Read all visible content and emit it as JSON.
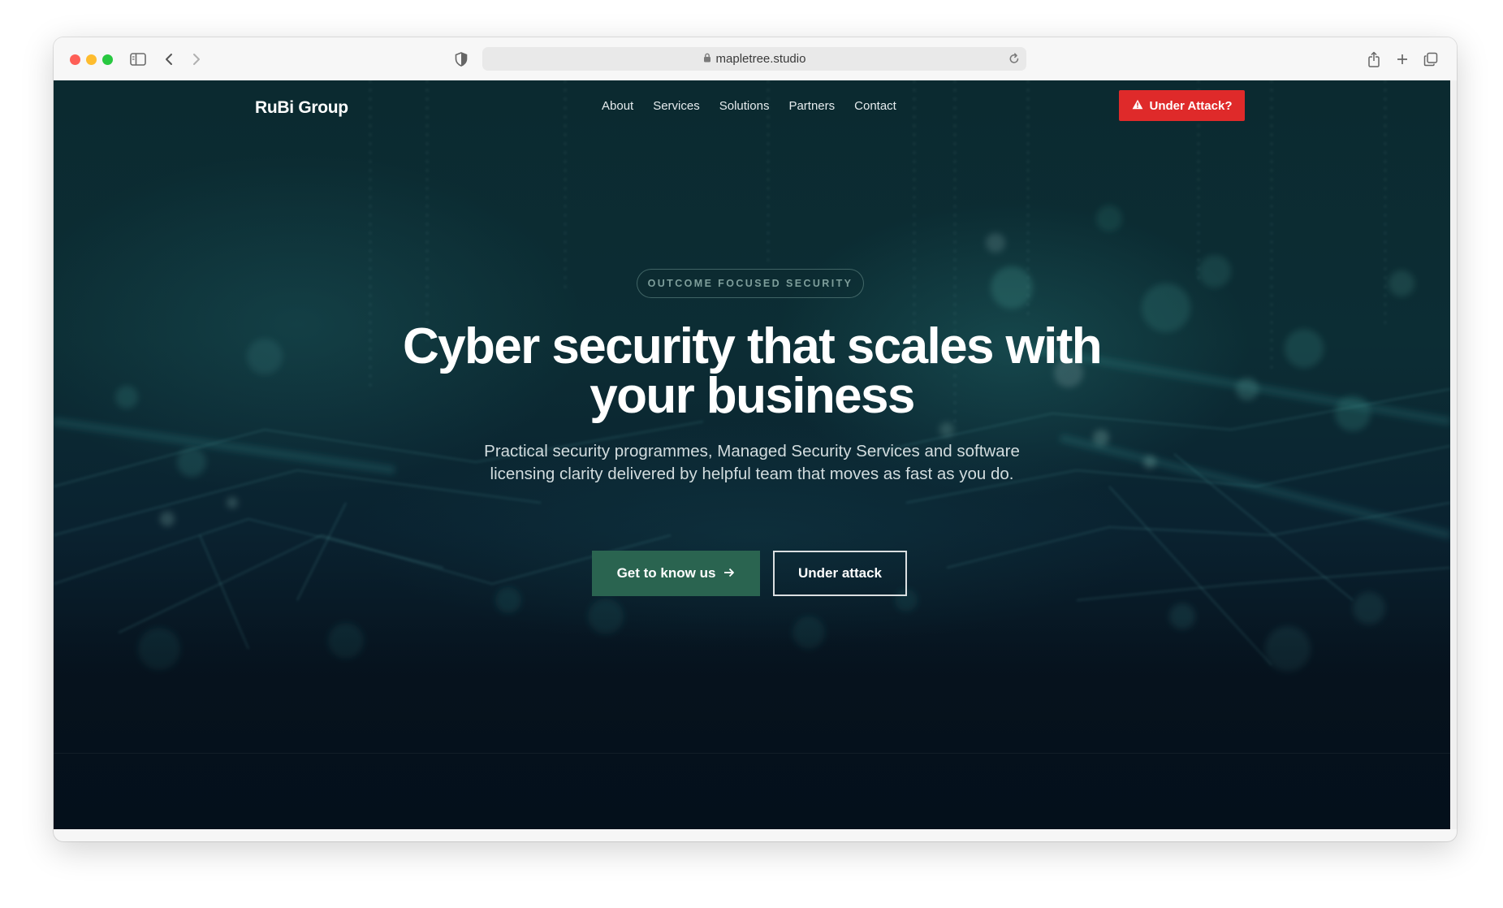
{
  "browser": {
    "url": "mapletree.studio"
  },
  "site": {
    "logo": "RuBi Group",
    "nav": [
      {
        "label": "About"
      },
      {
        "label": "Services"
      },
      {
        "label": "Solutions"
      },
      {
        "label": "Partners"
      },
      {
        "label": "Contact"
      }
    ],
    "attack_button": "Under Attack?"
  },
  "hero": {
    "badge": "OUTCOME FOCUSED SECURITY",
    "headline_line1": "Cyber security that scales with",
    "headline_line2": "your business",
    "subhead_line1": "Practical security programmes, Managed Security Services and software",
    "subhead_line2": "licensing clarity delivered by helpful team that moves as fast as you do.",
    "primary_cta": "Get to know us",
    "secondary_cta": "Under attack"
  },
  "colors": {
    "attack_red": "#df2a2a",
    "primary_green": "#2a6450",
    "hero_dark": "#06121d"
  }
}
